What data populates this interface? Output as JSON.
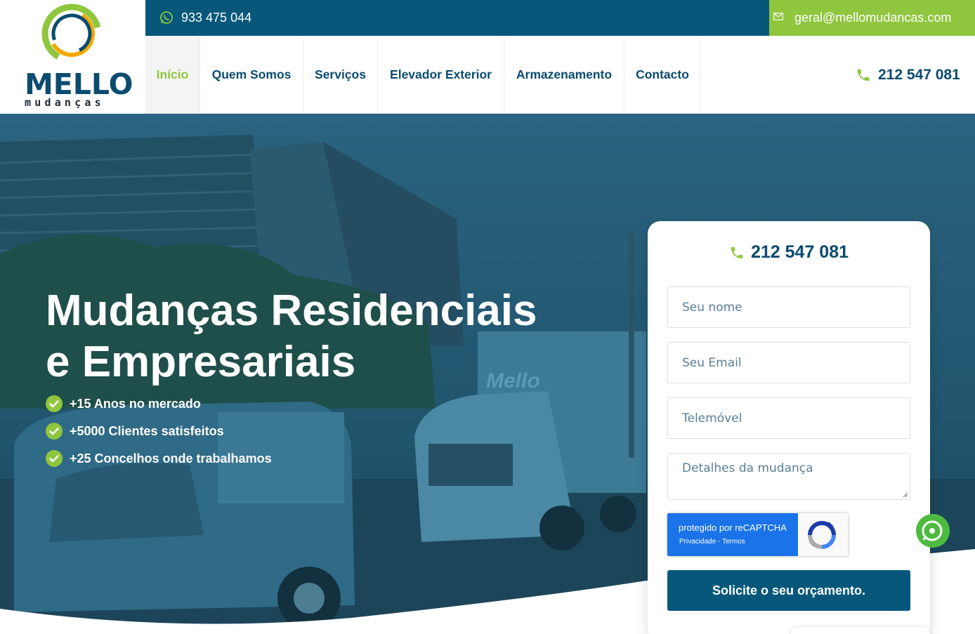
{
  "brand": {
    "name": "MELLO",
    "tagline": "mudanças"
  },
  "topbar": {
    "whatsapp_phone": "933 475 044",
    "email": "geral@mellomudancas.com"
  },
  "nav": {
    "items": [
      {
        "label": "Início",
        "active": true
      },
      {
        "label": "Quem Somos"
      },
      {
        "label": "Serviços"
      },
      {
        "label": "Elevador Exterior"
      },
      {
        "label": "Armazenamento"
      },
      {
        "label": "Contacto"
      }
    ],
    "phone": "212 547 081"
  },
  "hero": {
    "title_line1": "Mudanças Residenciais",
    "title_line2": "e Empresariais",
    "features": [
      "+15 Anos no mercado",
      "+5000 Clientes satisfeitos",
      "+25 Concelhos onde trabalhamos"
    ],
    "van_text": "Mello"
  },
  "form": {
    "phone": "212 547 081",
    "name_placeholder": "Seu nome",
    "email_placeholder": "Seu Email",
    "phone_placeholder": "Telemóvel",
    "details_placeholder": "Detalhes da mudança",
    "recaptcha_label": "protegido por reCAPTCHA",
    "recaptcha_links": "Privacidade - Termos",
    "submit_label": "Solicite o seu orçamento."
  },
  "colors": {
    "primary": "#06577a",
    "accent": "#8fc63e",
    "text_dark": "#0b4b6f"
  }
}
